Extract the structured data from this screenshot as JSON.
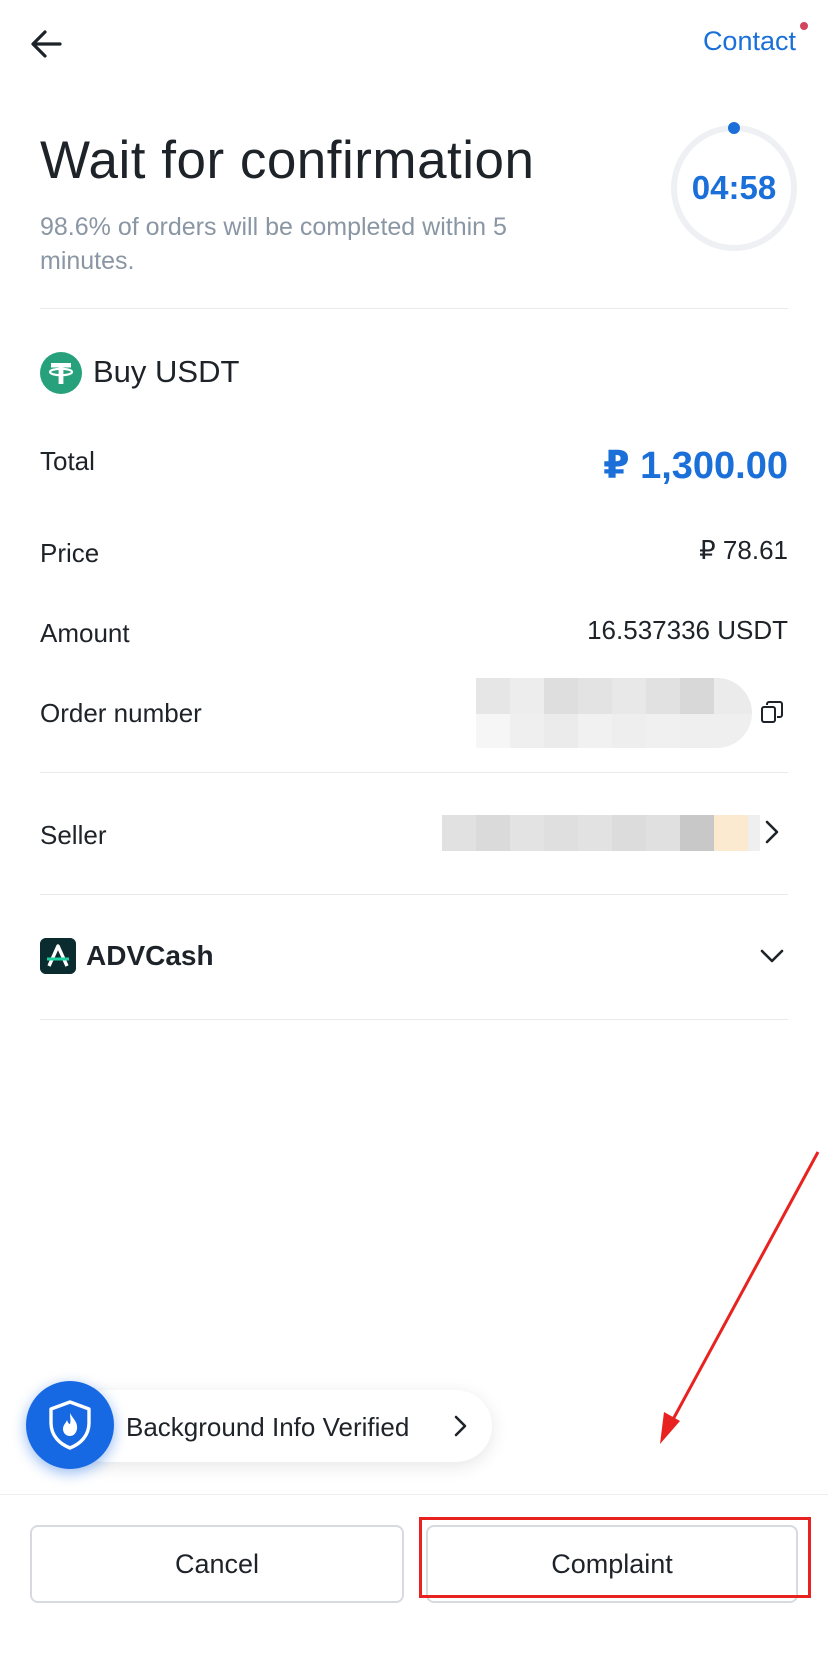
{
  "header": {
    "back_icon": "arrow-left-icon",
    "contact_label": "Contact",
    "notification_dot_color": "#d1465d"
  },
  "status": {
    "title": "Wait for confirmation",
    "subtitle": "98.6% of orders will be completed within 5 minutes.",
    "timer": "04:58",
    "timer_progress": 0.99
  },
  "order": {
    "asset_icon": "tether-icon",
    "title": "Buy USDT",
    "total_label": "Total",
    "total_value": "₽ 1,300.00",
    "price_label": "Price",
    "price_value": "₽ 78.61",
    "amount_label": "Amount",
    "amount_value": "16.537336 USDT",
    "order_number_label": "Order number",
    "order_number_value": "",
    "copy_icon": "copy-icon"
  },
  "seller": {
    "label": "Seller",
    "value": ""
  },
  "payment": {
    "method_icon": "advcash-icon",
    "method_label": "ADVCash"
  },
  "verification": {
    "icon": "shield-fire-icon",
    "label": "Background Info Verified"
  },
  "actions": {
    "cancel_label": "Cancel",
    "complaint_label": "Complaint"
  },
  "colors": {
    "accent": "#1a6fd9",
    "text": "#1e2329",
    "muted": "#8a96a3",
    "annotation": "#e8231f"
  }
}
